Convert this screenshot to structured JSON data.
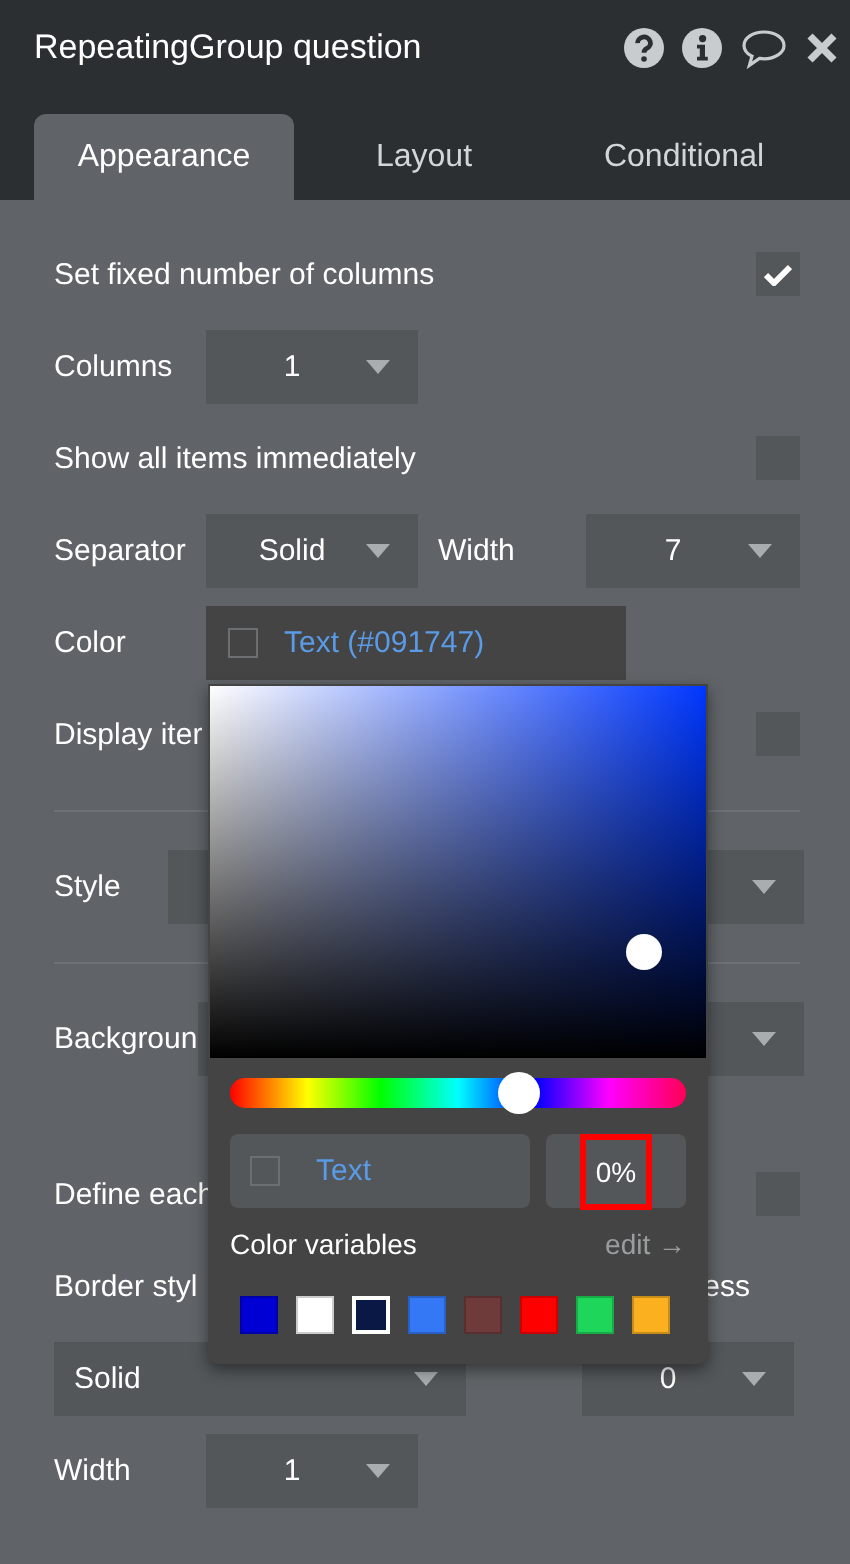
{
  "header": {
    "title": "RepeatingGroup question"
  },
  "tabs": [
    {
      "label": "Appearance",
      "selected": true
    },
    {
      "label": "Layout",
      "selected": false
    },
    {
      "label": "Conditional",
      "selected": false
    }
  ],
  "rows": [
    {
      "kind": "checkbox",
      "label": "Set fixed number of columns",
      "checked": true
    },
    {
      "kind": "select",
      "label": "Columns",
      "value": "1"
    },
    {
      "kind": "checkbox",
      "label": "Show all items immediately",
      "checked": false
    },
    {
      "kind": "select_pair",
      "label": "Separator",
      "value": "Solid",
      "label_2": "Width",
      "value_2": "7"
    },
    {
      "kind": "color",
      "label": "Color",
      "value": "Text (#091747)"
    },
    {
      "kind": "checkbox",
      "label": "Display iter",
      "checked": false
    },
    {
      "kind": "section_select",
      "label": "Style"
    },
    {
      "kind": "section_select",
      "label": "Backgroun"
    },
    {
      "kind": "checkbox",
      "label": "Define each",
      "checked": false
    },
    {
      "kind": "label_pair",
      "label": "Border styl",
      "label_2": "ess"
    },
    {
      "kind": "select_pair",
      "value": "Solid",
      "value_2": "0"
    },
    {
      "kind": "select",
      "label": "Width",
      "value": "1"
    }
  ],
  "color_picker": {
    "hue": {
      "level": 0.63
    },
    "color_field": {
      "value": "Text"
    },
    "opacity": {
      "value": "0%",
      "highlighted": true
    },
    "variables_label": "Color variables",
    "edit_link": "edit →",
    "swatches": [
      {
        "color": "#0000d4",
        "selected": false
      },
      {
        "color": "#ffffff",
        "selected": false
      },
      {
        "color": "#0a1845",
        "selected": true
      },
      {
        "color": "#3478f6",
        "selected": false
      },
      {
        "color": "#6e3a3a",
        "selected": false
      },
      {
        "color": "#ff0000",
        "selected": false
      },
      {
        "color": "#1ed65a",
        "selected": false
      },
      {
        "color": "#fbb11f",
        "selected": false
      }
    ]
  }
}
